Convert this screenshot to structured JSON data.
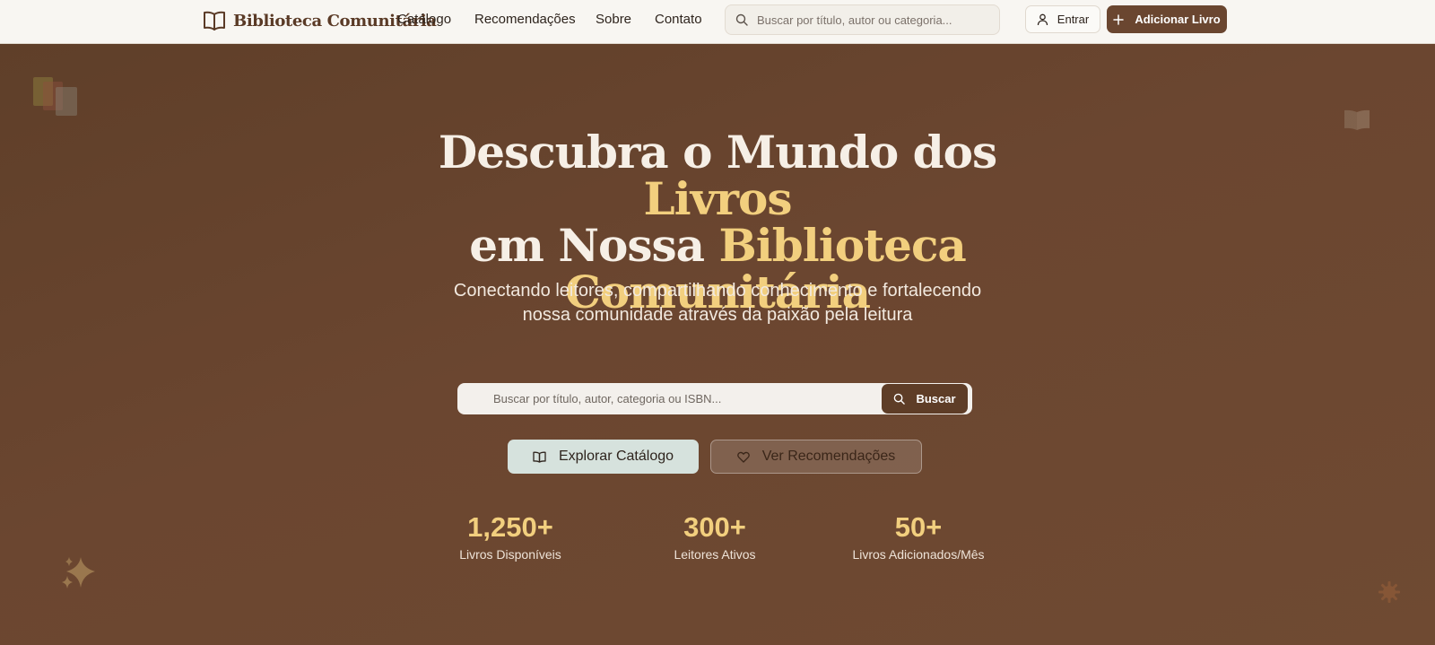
{
  "nav": {
    "brand": "Biblioteca Comunitária",
    "links": [
      "Catálogo",
      "Recomendações",
      "Sobre",
      "Contato"
    ],
    "search_placeholder": "Buscar por título, autor ou categoria...",
    "login_label": "Entrar",
    "add_label": "Adicionar Livro"
  },
  "hero": {
    "headline_line1": "Descubra o Mundo dos ",
    "headline_hl1": "Livros",
    "headline_line2": "em Nossa ",
    "headline_hl2": "Biblioteca",
    "headline_hl3": "Comunitária",
    "subtitle": "Conectando leitores, compartilhando conhecimento e fortalecendo nossa comunidade através da paixão pela leitura",
    "search_placeholder": "Buscar por título, autor, categoria ou ISBN...",
    "search_button": "Buscar",
    "explore_button": "Explorar Catálogo",
    "recommendations_button": "Ver Recomendações",
    "stats": [
      {
        "value": "1,250+",
        "label": "Livros Disponíveis"
      },
      {
        "value": "300+",
        "label": "Leitores Ativos"
      },
      {
        "value": "50+",
        "label": "Livros Adicionados/Mês"
      }
    ]
  },
  "icons": {
    "brand": "open-book-icon",
    "search": "search-icon",
    "user": "user-icon",
    "plus": "plus-icon",
    "book": "book-icon",
    "heart": "heart-icon",
    "sparkles": "sparkles-icon",
    "gear": "gear-icon"
  },
  "colors": {
    "accent": "#6a4630",
    "highlight": "#f2cf7e",
    "hero_bg": "#6a4630",
    "explore_bg": "#d6e2dd"
  }
}
